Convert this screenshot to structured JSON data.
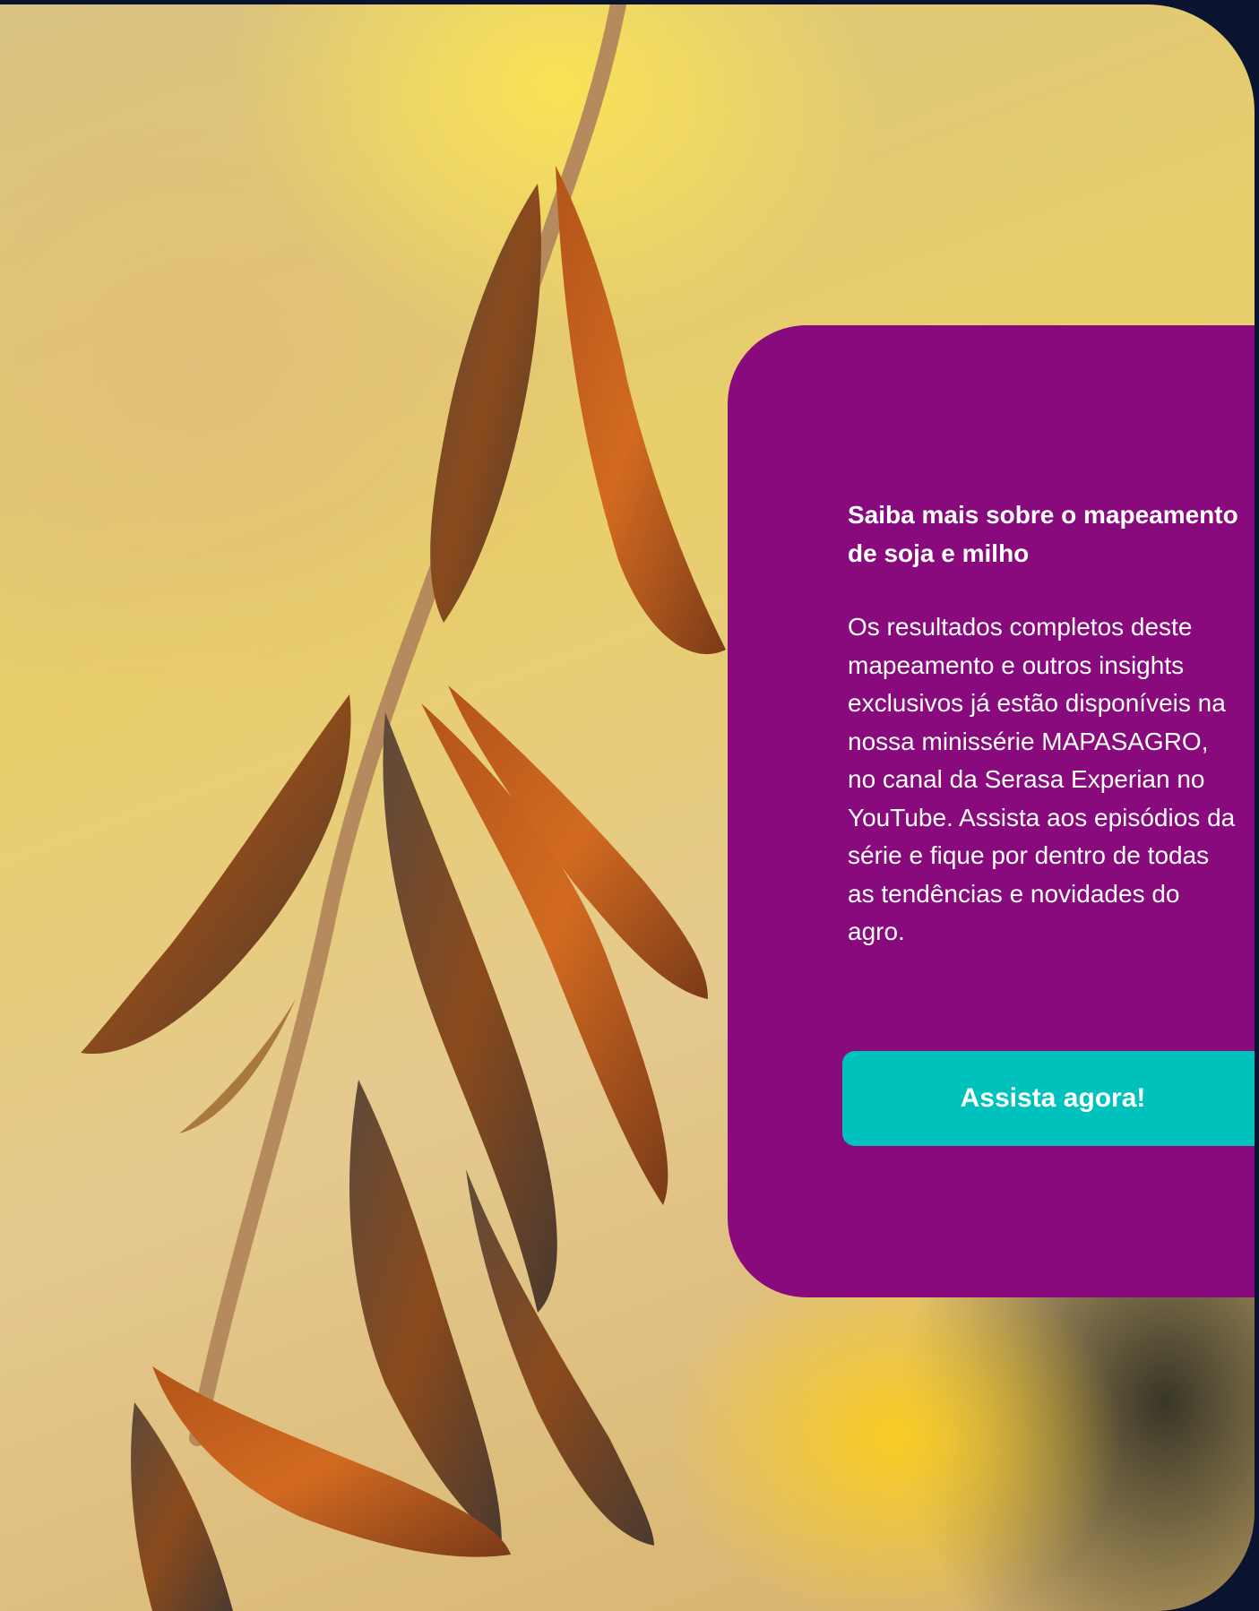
{
  "background": {
    "alt": "soybean-pods-photo"
  },
  "panel": {
    "title": "Saiba mais sobre o mapeamento de soja e milho",
    "body": "Os resultados completos deste mapeamento e outros insights exclusivos já estão disponíveis na nossa minissérie MAPASAGRO, no canal da Serasa Experian no YouTube. Assista aos episódios da série e fique por dentro de todas as tendências e novidades do agro.",
    "button_label": "Assista agora!"
  },
  "colors": {
    "page_bg": "#0a1430",
    "panel_bg": "#880a7c",
    "button_bg": "#00c2bd",
    "text": "#ffffff"
  }
}
